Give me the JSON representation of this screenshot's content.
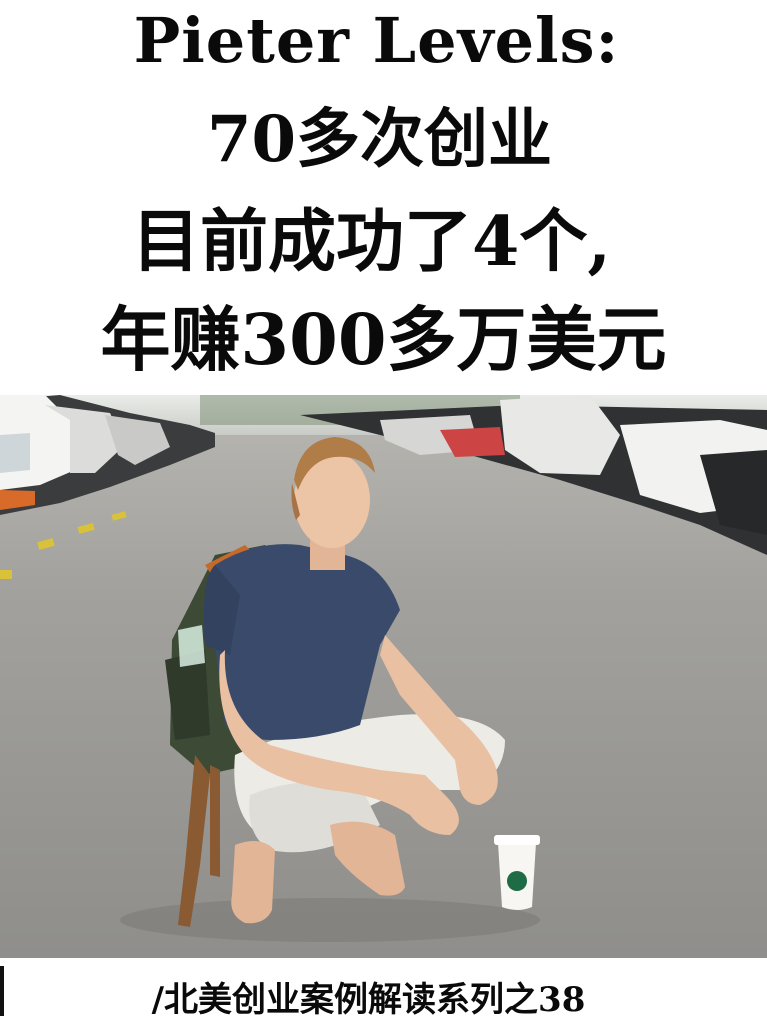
{
  "headline": {
    "line1": "Pieter Levels:",
    "line2": "70多次创业",
    "line3": "目前成功了4个,",
    "line4": "年赚300多万美元"
  },
  "footer": {
    "series_label": "/北美创业案例解读系列之38"
  },
  "photo": {
    "subject": "person-squatting-with-backpack-and-coffee-cup"
  },
  "colors": {
    "text": "#0a0a0a",
    "background": "#ffffff",
    "road": "#9a9a98"
  }
}
